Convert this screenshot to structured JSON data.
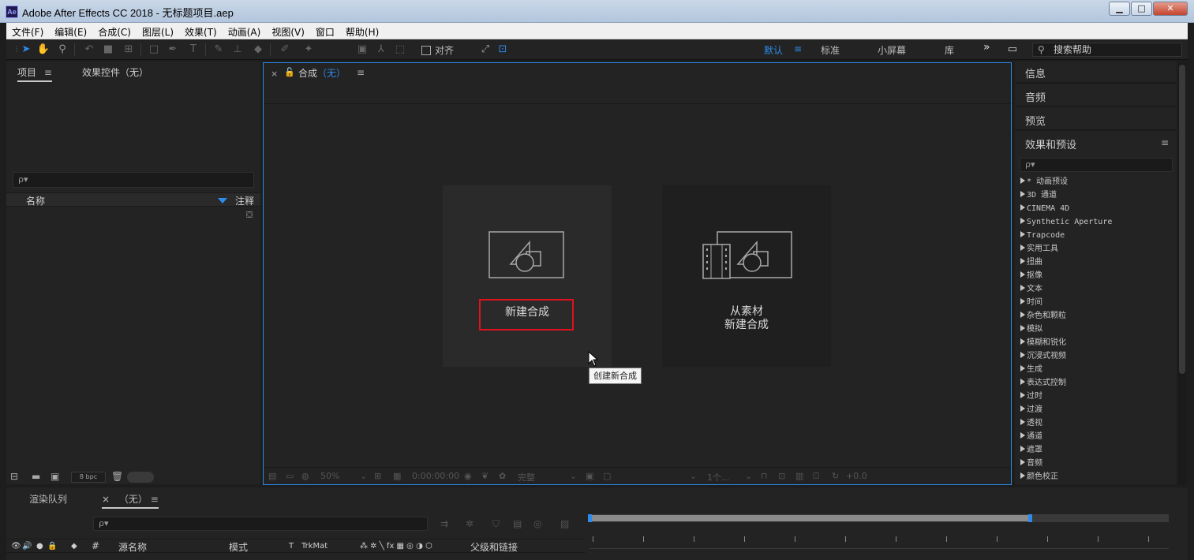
{
  "window": {
    "title": "Adobe After Effects CC 2018 - 无标题项目.aep",
    "logo": "Ae",
    "minimize": "▁",
    "maximize": "□",
    "close": "✕"
  },
  "menu": [
    "文件(F)",
    "编辑(E)",
    "合成(C)",
    "图层(L)",
    "效果(T)",
    "动画(A)",
    "视图(V)",
    "窗口",
    "帮助(H)"
  ],
  "toolbar": {
    "snap_label": "对齐",
    "workspaces": [
      "默认",
      "标准",
      "小屏幕",
      "库"
    ],
    "more": "»",
    "search_help": "搜索帮助",
    "accent": "#2d8ceb"
  },
  "project_panel": {
    "tab_project": "项目",
    "tab_effects_controls": "效果控件（无）",
    "menu_icon": "≡",
    "search_placeholder": "ρ▾",
    "col_name": "名称",
    "col_comment": "注释",
    "bpc": "8 bpc"
  },
  "comp_panel": {
    "close": "×",
    "title": "合成",
    "subtitle": "（无）",
    "menu_icon": "≡",
    "new_comp": "新建合成",
    "from_footage_line1": "从素材",
    "from_footage_line2": "新建合成",
    "tooltip": "创建新合成",
    "footer": {
      "zoom": "50%",
      "timecode": "0:00:00:00",
      "quality": "完整",
      "views": "1个...",
      "exposure": "+0.0"
    },
    "highlight_color": "#e1111e"
  },
  "right_panel": {
    "info": "信息",
    "audio": "音频",
    "preview": "预览",
    "effects_presets": "效果和预设",
    "menu_icon": "≡",
    "search_placeholder": "ρ▾",
    "effects": [
      "* 动画预设",
      "3D 通道",
      "CINEMA 4D",
      "Synthetic Aperture",
      "Trapcode",
      "实用工具",
      "扭曲",
      "抠像",
      "文本",
      "时间",
      "杂色和颗粒",
      "模拟",
      "模糊和锐化",
      "沉浸式视频",
      "生成",
      "表达式控制",
      "过时",
      "过渡",
      "透视",
      "通道",
      "遮罩",
      "音频",
      "颜色校正"
    ]
  },
  "timeline": {
    "tab_render_queue": "渲染队列",
    "tab_close": "×",
    "tab_comp": "（无）",
    "menu_icon": "≡",
    "search_placeholder": "ρ▾",
    "col_hash": "#",
    "col_source_name": "源名称",
    "col_mode": "模式",
    "col_t": "T",
    "col_trkmat": "TrkMat",
    "col_parent": "父级和链接",
    "col_switches": "⁂ ✲ ╲ fx ▦ ◎ ◑ ⬡"
  }
}
